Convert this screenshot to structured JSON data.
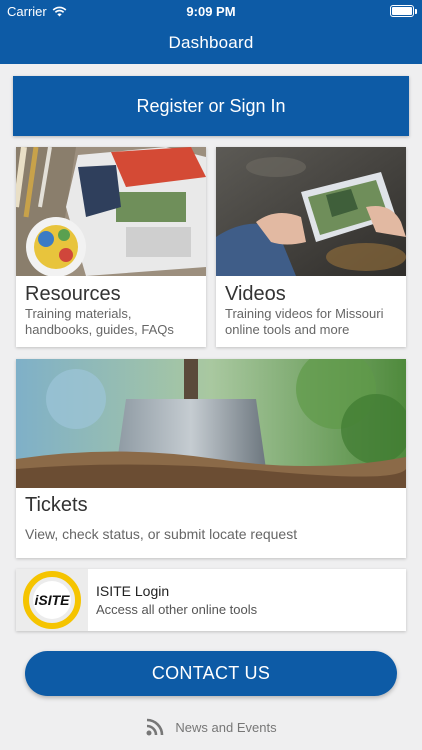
{
  "status_bar": {
    "carrier": "Carrier",
    "time": "9:09 PM"
  },
  "nav": {
    "title": "Dashboard"
  },
  "signin": {
    "label": "Register or Sign In"
  },
  "cards": {
    "resources": {
      "title": "Resources",
      "subtitle": "Training materials, handbooks, guides, FAQs"
    },
    "videos": {
      "title": "Videos",
      "subtitle": "Training videos for Missouri online tools and more"
    },
    "tickets": {
      "title": "Tickets",
      "subtitle": "View, check status, or submit locate request"
    }
  },
  "isite": {
    "title": "ISITE Login",
    "subtitle": "Access all other online tools",
    "logo_text": "iSITE"
  },
  "contact": {
    "label": "CONTACT US"
  },
  "news": {
    "label": "News and Events"
  },
  "colors": {
    "primary": "#0d5ba6",
    "background": "#efeff0",
    "isite_yellow": "#f5c400"
  }
}
